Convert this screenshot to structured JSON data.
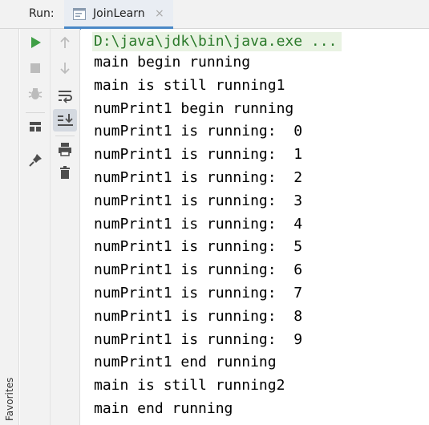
{
  "run_panel": {
    "label": "Run:",
    "tab": {
      "title": "JoinLearn",
      "close_glyph": "×"
    }
  },
  "side_strip": {
    "label": "Favorites"
  },
  "toolbar_left": [
    {
      "name": "rerun-icon",
      "color": "#3f9f46"
    },
    {
      "name": "stop-icon",
      "color": "#bcbcbc"
    },
    {
      "name": "debug-icon",
      "color": "#bcbcbc"
    },
    {
      "name": "layout-icon",
      "color": "#4e4e4e"
    },
    {
      "name": "pin-icon",
      "color": "#4e4e4e"
    }
  ],
  "toolbar_right": [
    {
      "name": "up-arrow-icon",
      "color": "#bcbcbc"
    },
    {
      "name": "down-arrow-icon",
      "color": "#bcbcbc"
    },
    {
      "name": "soft-wrap-icon",
      "color": "#4e4e4e"
    },
    {
      "name": "scroll-to-end-icon",
      "color": "#4e4e4e",
      "active": true
    },
    {
      "name": "print-icon",
      "color": "#4e4e4e"
    },
    {
      "name": "trash-icon",
      "color": "#4e4e4e"
    }
  ],
  "console": {
    "command": "D:\\java\\jdk\\bin\\java.exe ...",
    "lines": [
      "main begin running",
      "main is still running1",
      "numPrint1 begin running",
      "numPrint1 is running:  0",
      "numPrint1 is running:  1",
      "numPrint1 is running:  2",
      "numPrint1 is running:  3",
      "numPrint1 is running:  4",
      "numPrint1 is running:  5",
      "numPrint1 is running:  6",
      "numPrint1 is running:  7",
      "numPrint1 is running:  8",
      "numPrint1 is running:  9",
      "numPrint1 end running",
      "main is still running2",
      "main end running"
    ]
  },
  "colors": {
    "command_text": "#2b7a2b",
    "command_highlight": "#e9f3e3",
    "tab_underline": "#4a88c7"
  }
}
